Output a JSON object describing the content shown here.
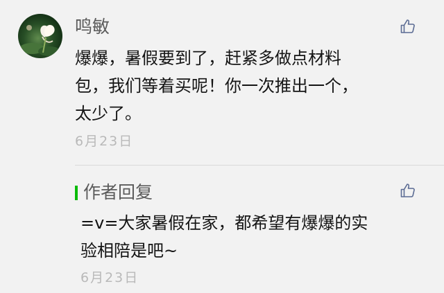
{
  "comment": {
    "author": "鸣敏",
    "avatar_icon": "lotus-avatar",
    "like_icon": "thumbs-up-icon",
    "text_lines": [
      "爆爆，暑假要到了，赶紧多做点材料",
      "包，我们等着买呢！你一次推出一个，",
      "太少了。"
    ],
    "date": "6月23日"
  },
  "reply": {
    "title": "作者回复",
    "like_icon": "thumbs-up-icon",
    "text_lines": [
      "=v=大家暑假在家，都希望有爆爆的实",
      "验相陪是吧~"
    ],
    "date": "6月23日"
  },
  "colors": {
    "background": "#f2f2f2",
    "accent_green": "#09bb07",
    "icon_blue": "#5b6b93",
    "meta_gray": "#b9b9b9"
  }
}
